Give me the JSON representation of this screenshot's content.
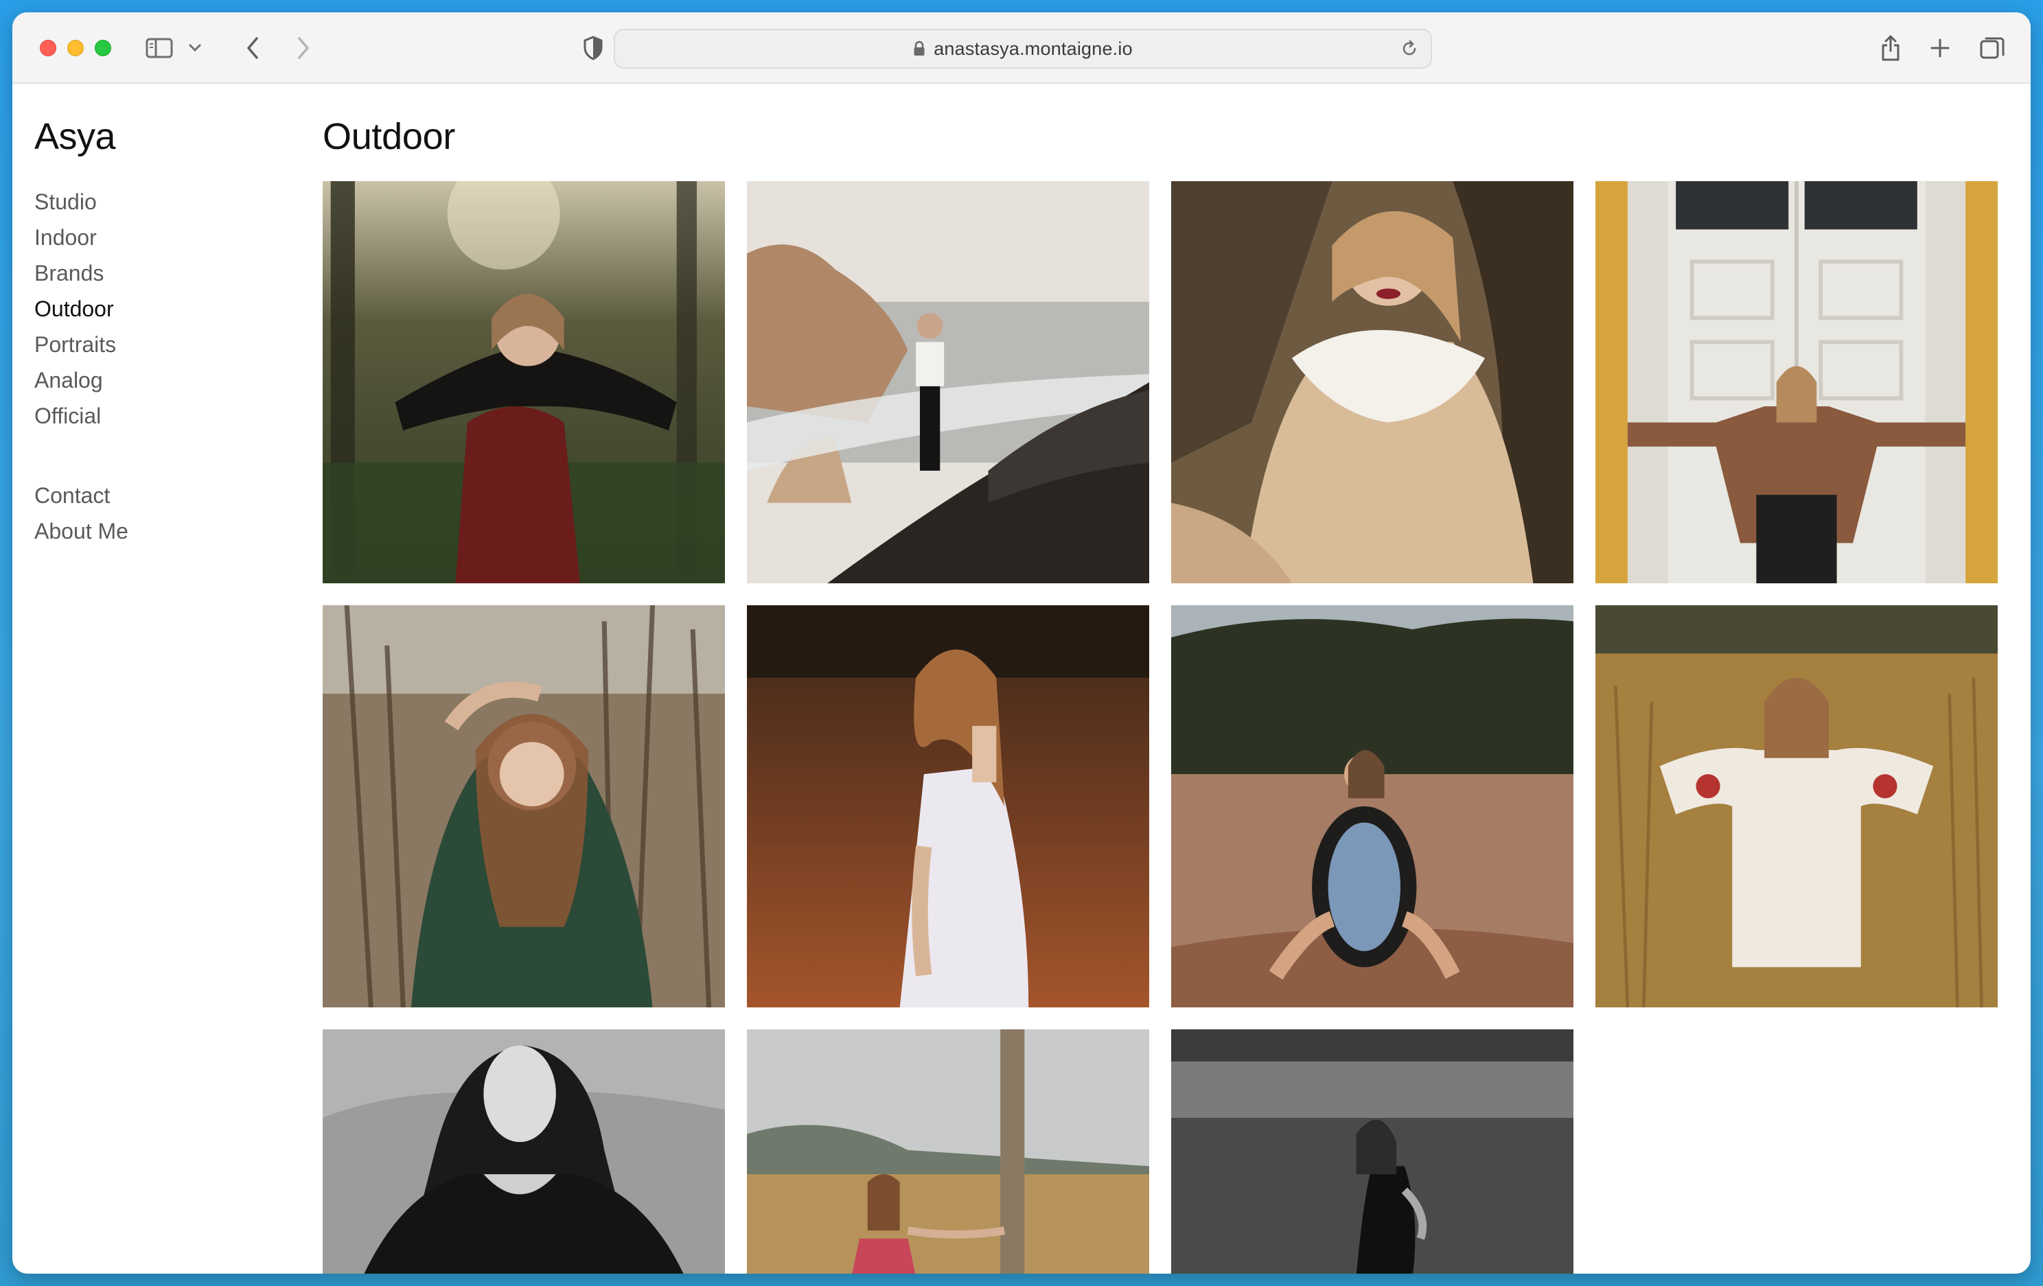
{
  "browser": {
    "url": "anastasya.montaigne.io"
  },
  "sidebar": {
    "site_title": "Asya",
    "nav": [
      {
        "label": "Studio"
      },
      {
        "label": "Indoor"
      },
      {
        "label": "Brands"
      },
      {
        "label": "Outdoor",
        "active": true
      },
      {
        "label": "Portraits"
      },
      {
        "label": "Analog"
      },
      {
        "label": "Official"
      }
    ],
    "secondary_nav": [
      {
        "label": "Contact"
      },
      {
        "label": "About Me"
      }
    ]
  },
  "main": {
    "page_title": "Outdoor",
    "photos": [
      {
        "name": "photo-forest-red-vest"
      },
      {
        "name": "photo-seaside-cliff"
      },
      {
        "name": "photo-lace-collar-rocks"
      },
      {
        "name": "photo-door-plaid-jacket"
      },
      {
        "name": "photo-reeds-green-blouse"
      },
      {
        "name": "photo-white-dress-sunset"
      },
      {
        "name": "photo-mirror-beach"
      },
      {
        "name": "photo-field-embroidered-blouse"
      },
      {
        "name": "photo-bw-portrait"
      },
      {
        "name": "photo-pole-field"
      },
      {
        "name": "photo-lake-swimsuit"
      }
    ]
  }
}
